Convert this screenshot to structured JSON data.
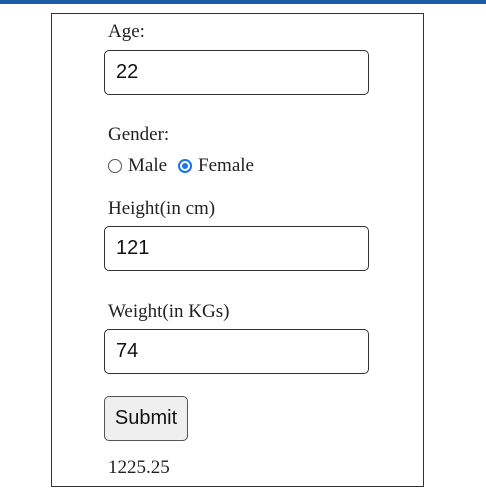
{
  "form": {
    "age": {
      "label": "Age:",
      "value": "22"
    },
    "gender": {
      "label": "Gender:",
      "options": [
        {
          "label": "Male",
          "checked": false
        },
        {
          "label": "Female",
          "checked": true
        }
      ]
    },
    "height": {
      "label": "Height(in cm)",
      "value": "121"
    },
    "weight": {
      "label": "Weight(in KGs)",
      "value": "74"
    },
    "submit_label": "Submit",
    "result": "1225.25"
  },
  "colors": {
    "accent": "#1a73e8",
    "topbar": "#1f5aa6"
  }
}
